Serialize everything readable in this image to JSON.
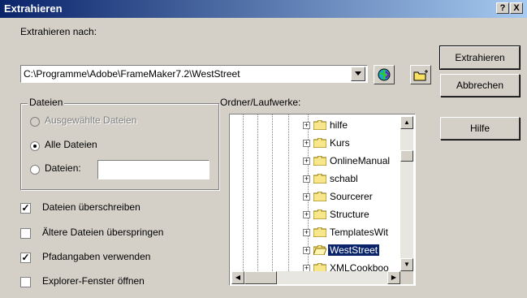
{
  "window": {
    "title": "Extrahieren",
    "help_btn": "?",
    "close_btn": "X"
  },
  "extract_to": {
    "label": "Extrahieren nach:",
    "path": "C:\\Programme\\Adobe\\FrameMaker7.2\\WestStreet"
  },
  "buttons": {
    "extract": "Extrahieren",
    "cancel": "Abbrechen",
    "help": "Hilfe"
  },
  "files_group": {
    "legend": "Dateien",
    "selected": "Ausgewählte Dateien",
    "all": "Alle Dateien",
    "files": "Dateien:",
    "files_value": ""
  },
  "options": {
    "overwrite": {
      "label": "Dateien überschreiben",
      "checked": true
    },
    "skip_older": {
      "label": "Ältere Dateien überspringen",
      "checked": false
    },
    "use_paths": {
      "label": "Pfadangaben verwenden",
      "checked": true
    },
    "open_explorer": {
      "label": "Explorer-Fenster öffnen",
      "checked": false
    }
  },
  "folders": {
    "label": "Ordner/Laufwerke:",
    "items": [
      "hilfe",
      "Kurs",
      "OnlineManual",
      "schabl",
      "Sourcerer",
      "Structure",
      "TemplatesWit",
      "WestStreet",
      "XMLCookboo"
    ],
    "selected": "WestStreet"
  },
  "colors": {
    "title_start": "#0a246a",
    "title_end": "#a6caf0",
    "selection": "#0a246a",
    "face": "#d4d0c8"
  }
}
